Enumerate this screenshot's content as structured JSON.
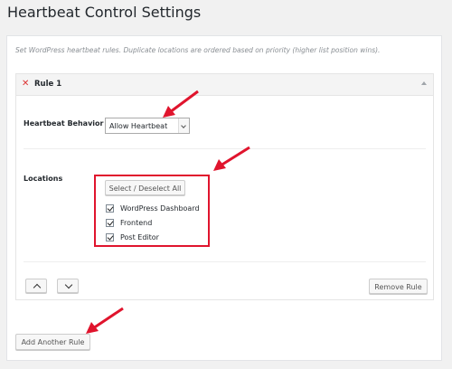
{
  "page": {
    "title": "Heartbeat Control Settings",
    "description": "Set WordPress heartbeat rules. Duplicate locations are ordered based on priority (higher list position wins)."
  },
  "rule": {
    "title": "Rule 1",
    "remove_glyph": "✕",
    "behavior_label": "Heartbeat Behavior",
    "behavior_value": "Allow Heartbeat",
    "locations_label": "Locations",
    "select_all_label": "Select / Deselect All",
    "locations": [
      {
        "label": "WordPress Dashboard",
        "checked": true
      },
      {
        "label": "Frontend",
        "checked": true
      },
      {
        "label": "Post Editor",
        "checked": true
      }
    ],
    "remove_rule_label": "Remove Rule"
  },
  "actions": {
    "add_rule_label": "Add Another Rule"
  },
  "colors": {
    "annotation": "#e0142d",
    "remove_x": "#dc3232",
    "page_background": "#f1f1f1"
  },
  "icons": [
    "close-icon",
    "collapse-caret-icon",
    "dropdown-arrow-icon",
    "chevron-up-icon",
    "chevron-down-icon",
    "checkmark-icon"
  ]
}
